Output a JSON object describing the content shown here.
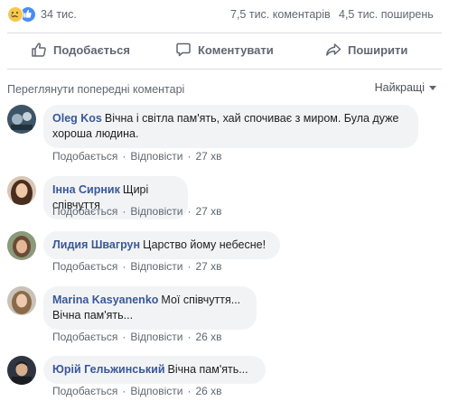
{
  "stats": {
    "reactions_count": "34 тис.",
    "comments": "7,5 тис. коментарів",
    "shares": "4,5 тис. поширень",
    "reaction_icons": [
      "sad-face-icon",
      "like-thumb-icon"
    ]
  },
  "actions": {
    "like_label": "Подобається",
    "comment_label": "Коментувати",
    "share_label": "Поширити"
  },
  "comments_header": {
    "previous_label": "Переглянути попередні коментарі",
    "sort_label": "Найкращі"
  },
  "comments": [
    {
      "author": "Oleg Kos",
      "text": "Вічна і світла пам'ять, хай спочиває з миром. Була дуже хороша людина.",
      "like": "Подобається",
      "reply": "Відповісти",
      "time": "27 хв"
    },
    {
      "author": "Інна Сирник",
      "text": "Щирі співчуття",
      "like": "Подобається",
      "reply": "Відповісти",
      "time": "27 хв"
    },
    {
      "author": "Лидия Швагрун",
      "text": "Царство йому небесне!",
      "like": "Подобається",
      "reply": "Відповісти",
      "time": "27 хв"
    },
    {
      "author": "Marina Kasyanenko",
      "text": "Мої співчуття... Вічна пам'ять...",
      "like": "Подобається",
      "reply": "Відповісти",
      "time": "26 хв"
    },
    {
      "author": "Юрій Гельжинський",
      "text": "Вічна пам'ять...",
      "like": "Подобається",
      "reply": "Відповісти",
      "time": "26 хв"
    }
  ],
  "colors": {
    "author_link": "#385898",
    "bubble_bg": "#f2f3f5",
    "muted_text": "#606770"
  }
}
